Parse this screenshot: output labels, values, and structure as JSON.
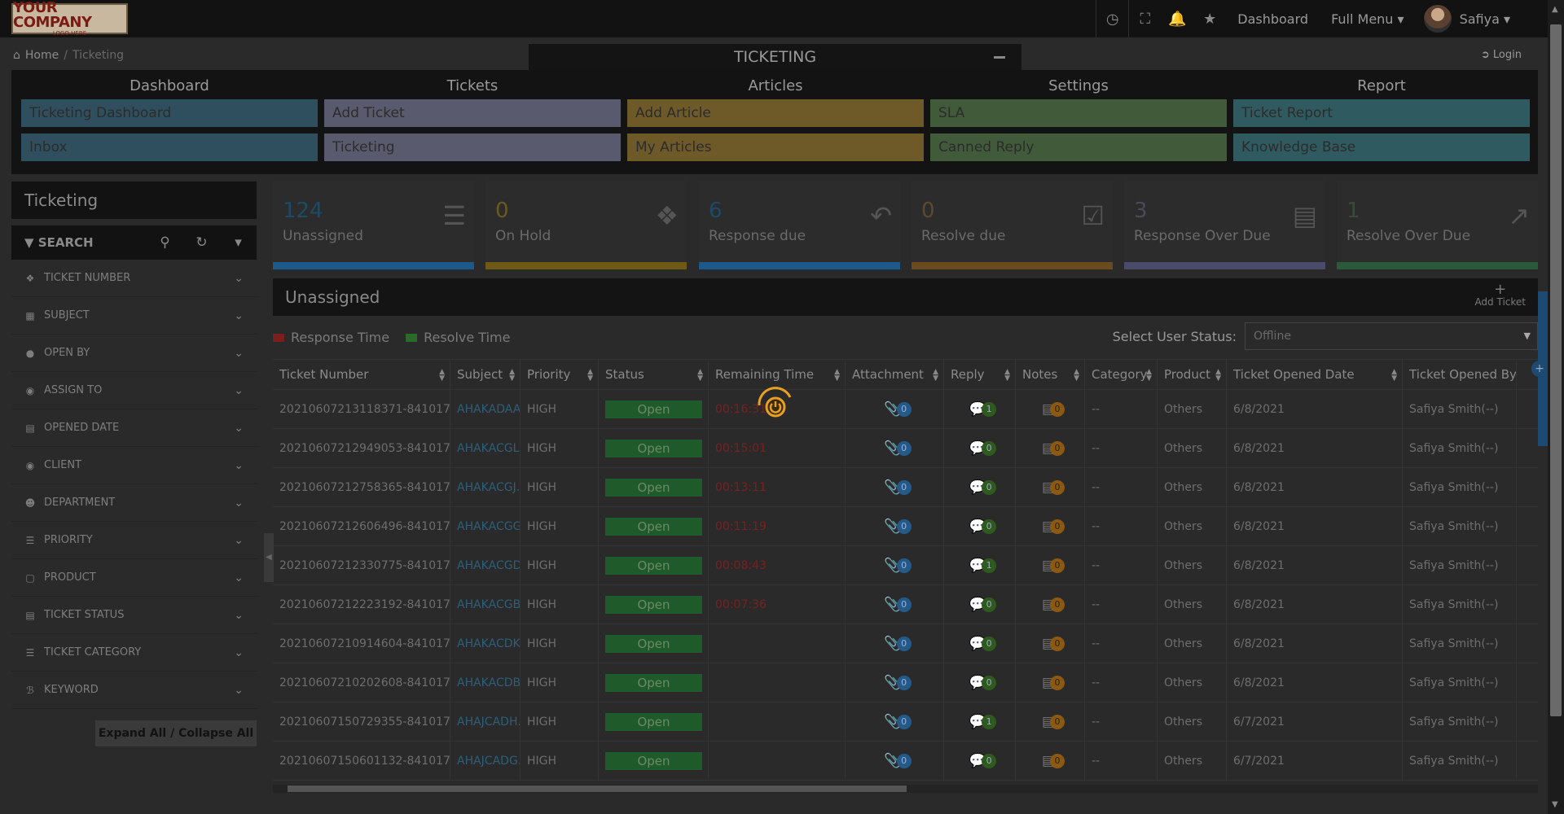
{
  "brand": {
    "logo_text": "YOUR COMPANY",
    "logo_sub": "LOGO HERE"
  },
  "topbar": {
    "dashboard": "Dashboard",
    "full_menu": "Full Menu",
    "user_name": "Safiya"
  },
  "breadcrumb": {
    "home": "Home",
    "current": "Ticketing"
  },
  "module_title": "TICKETING",
  "login": "Login",
  "menu": [
    {
      "head": "Dashboard",
      "items": [
        "Ticketing Dashboard",
        "Inbox"
      ]
    },
    {
      "head": "Tickets",
      "items": [
        "Add Ticket",
        "Ticketing"
      ]
    },
    {
      "head": "Articles",
      "items": [
        "Add Article",
        "My Articles"
      ]
    },
    {
      "head": "Settings",
      "items": [
        "SLA",
        "Canned Reply"
      ]
    },
    {
      "head": "Report",
      "items": [
        "Ticket Report",
        "Knowledge Base"
      ]
    }
  ],
  "sidebar": {
    "title": "Ticketing",
    "search_label": "SEARCH",
    "filters": [
      "TICKET NUMBER",
      "SUBJECT",
      "OPEN BY",
      "ASSIGN TO",
      "OPENED DATE",
      "CLIENT",
      "DEPARTMENT",
      "PRIORITY",
      "PRODUCT",
      "TICKET STATUS",
      "TICKET CATEGORY",
      "KEYWORD"
    ],
    "expand_label": "Expand All / Collapse All"
  },
  "stats": [
    {
      "value": "124",
      "label": "Unassigned",
      "color": "#1e4a66",
      "bar": "#1d5a8a"
    },
    {
      "value": "0",
      "label": "On Hold",
      "color": "#6a5a1e",
      "bar": "#6e5a14"
    },
    {
      "value": "6",
      "label": "Response due",
      "color": "#1e4a66",
      "bar": "#1d5a8a"
    },
    {
      "value": "0",
      "label": "Resolve due",
      "color": "#5a4a30",
      "bar": "#6a4a1e"
    },
    {
      "value": "3",
      "label": "Response Over Due",
      "color": "#4a4a5a",
      "bar": "#4a4a6a"
    },
    {
      "value": "1",
      "label": "Resolve Over Due",
      "color": "#3a4a3a",
      "bar": "#2a5a3a"
    }
  ],
  "panel": {
    "title": "Unassigned",
    "add_ticket": "Add Ticket",
    "legend_response": "Response Time",
    "legend_resolve": "Resolve Time",
    "status_label": "Select User Status:",
    "status_value": "Offline"
  },
  "table": {
    "headers": [
      "Ticket Number",
      "Subject",
      "Priority",
      "Status",
      "Remaining Time",
      "Attachment",
      "Reply",
      "Notes",
      "Category",
      "Product",
      "Ticket Opened Date",
      "Ticket Opened By"
    ],
    "rows": [
      {
        "number": "20210607213118371-841017",
        "subject": "AHAKADAA..",
        "priority": "HIGH",
        "status": "Open",
        "remaining": "00:16:31",
        "attach": "0",
        "reply": "1",
        "notes": "0",
        "category": "--",
        "product": "Others",
        "date": "6/8/2021",
        "by": "Safiya Smith(--)"
      },
      {
        "number": "20210607212949053-841017",
        "subject": "AHAKACGL..",
        "priority": "HIGH",
        "status": "Open",
        "remaining": "00:15:01",
        "attach": "0",
        "reply": "0",
        "notes": "0",
        "category": "--",
        "product": "Others",
        "date": "6/8/2021",
        "by": "Safiya Smith(--)"
      },
      {
        "number": "20210607212758365-841017",
        "subject": "AHAKACGJ..",
        "priority": "HIGH",
        "status": "Open",
        "remaining": "00:13:11",
        "attach": "0",
        "reply": "0",
        "notes": "0",
        "category": "--",
        "product": "Others",
        "date": "6/8/2021",
        "by": "Safiya Smith(--)"
      },
      {
        "number": "20210607212606496-841017",
        "subject": "AHAKACGG..",
        "priority": "HIGH",
        "status": "Open",
        "remaining": "00:11:19",
        "attach": "0",
        "reply": "0",
        "notes": "0",
        "category": "--",
        "product": "Others",
        "date": "6/8/2021",
        "by": "Safiya Smith(--)"
      },
      {
        "number": "20210607212330775-841017",
        "subject": "AHAKACGD..",
        "priority": "HIGH",
        "status": "Open",
        "remaining": "00:08:43",
        "attach": "0",
        "reply": "1",
        "notes": "0",
        "category": "--",
        "product": "Others",
        "date": "6/8/2021",
        "by": "Safiya Smith(--)"
      },
      {
        "number": "20210607212223192-841017",
        "subject": "AHAKACGB..",
        "priority": "HIGH",
        "status": "Open",
        "remaining": "00:07:36",
        "attach": "0",
        "reply": "0",
        "notes": "0",
        "category": "--",
        "product": "Others",
        "date": "6/8/2021",
        "by": "Safiya Smith(--)"
      },
      {
        "number": "20210607210914604-841017",
        "subject": "AHAKACDK..",
        "priority": "HIGH",
        "status": "Open",
        "remaining": "",
        "attach": "0",
        "reply": "0",
        "notes": "0",
        "category": "--",
        "product": "Others",
        "date": "6/8/2021",
        "by": "Safiya Smith(--)"
      },
      {
        "number": "20210607210202608-841017",
        "subject": "AHAKACDB..",
        "priority": "HIGH",
        "status": "Open",
        "remaining": "",
        "attach": "0",
        "reply": "0",
        "notes": "0",
        "category": "--",
        "product": "Others",
        "date": "6/8/2021",
        "by": "Safiya Smith(--)"
      },
      {
        "number": "20210607150729355-841017",
        "subject": "AHAJCADH..",
        "priority": "HIGH",
        "status": "Open",
        "remaining": "",
        "attach": "0",
        "reply": "1",
        "notes": "0",
        "category": "--",
        "product": "Others",
        "date": "6/7/2021",
        "by": "Safiya Smith(--)"
      },
      {
        "number": "20210607150601132-841017",
        "subject": "AHAJCADG..",
        "priority": "HIGH",
        "status": "Open",
        "remaining": "",
        "attach": "0",
        "reply": "0",
        "notes": "0",
        "category": "--",
        "product": "Others",
        "date": "6/7/2021",
        "by": "Safiya Smith(--)"
      }
    ]
  }
}
